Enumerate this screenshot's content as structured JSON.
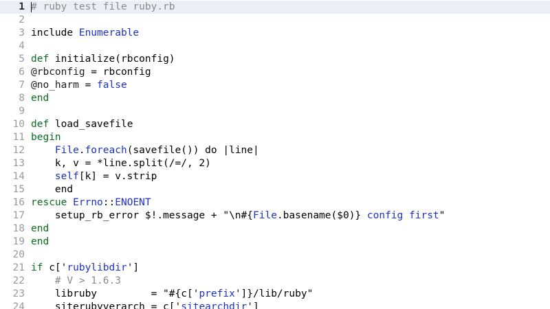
{
  "editor": {
    "colors": {
      "keyword": "#0a6c1f",
      "constant": "#1b31c9",
      "string": "#000000",
      "comment": "#8a8a8a",
      "ivar": "#1a1a1a",
      "plain": "#000000",
      "lineNumber": "#9a9a9a",
      "currentLine": "#ebeff5"
    },
    "current_line": 1,
    "lines": [
      {
        "num": "1",
        "tokens": [
          {
            "t": "# ruby test file ruby.rb",
            "c": "comment"
          }
        ]
      },
      {
        "num": "2",
        "tokens": []
      },
      {
        "num": "3",
        "tokens": [
          {
            "t": "include ",
            "c": "plain"
          },
          {
            "t": "Enumerable",
            "c": "constant"
          }
        ]
      },
      {
        "num": "4",
        "tokens": []
      },
      {
        "num": "5",
        "tokens": [
          {
            "t": "def",
            "c": "keyword"
          },
          {
            "t": " initialize(rbconfig)",
            "c": "plain"
          }
        ]
      },
      {
        "num": "6",
        "tokens": [
          {
            "t": "@rbconfig",
            "c": "ivar"
          },
          {
            "t": " = rbconfig",
            "c": "plain"
          }
        ]
      },
      {
        "num": "7",
        "tokens": [
          {
            "t": "@no_harm",
            "c": "ivar"
          },
          {
            "t": " = ",
            "c": "plain"
          },
          {
            "t": "false",
            "c": "constant"
          }
        ]
      },
      {
        "num": "8",
        "tokens": [
          {
            "t": "end",
            "c": "keyword"
          }
        ]
      },
      {
        "num": "9",
        "tokens": []
      },
      {
        "num": "10",
        "tokens": [
          {
            "t": "def",
            "c": "keyword"
          },
          {
            "t": " load_savefile",
            "c": "plain"
          }
        ]
      },
      {
        "num": "11",
        "tokens": [
          {
            "t": "begin",
            "c": "keyword"
          }
        ]
      },
      {
        "num": "12",
        "tokens": [
          {
            "t": "    ",
            "c": "plain"
          },
          {
            "t": "File",
            "c": "constant"
          },
          {
            "t": ".",
            "c": "plain"
          },
          {
            "t": "foreach",
            "c": "constant"
          },
          {
            "t": "(savefile()) do |line|",
            "c": "plain"
          }
        ]
      },
      {
        "num": "13",
        "tokens": [
          {
            "t": "    k, v = *line.split(/=/, 2)",
            "c": "plain"
          }
        ]
      },
      {
        "num": "14",
        "tokens": [
          {
            "t": "    ",
            "c": "plain"
          },
          {
            "t": "self",
            "c": "constant"
          },
          {
            "t": "[k] = v.strip",
            "c": "plain"
          }
        ]
      },
      {
        "num": "15",
        "tokens": [
          {
            "t": "    end",
            "c": "plain"
          }
        ]
      },
      {
        "num": "16",
        "tokens": [
          {
            "t": "rescue",
            "c": "keyword"
          },
          {
            "t": " ",
            "c": "plain"
          },
          {
            "t": "Errno",
            "c": "constant"
          },
          {
            "t": "::",
            "c": "plain"
          },
          {
            "t": "ENOENT",
            "c": "constant"
          }
        ]
      },
      {
        "num": "17",
        "tokens": [
          {
            "t": "    setup_rb_error $!.message + \"\\n#{",
            "c": "plain"
          },
          {
            "t": "File",
            "c": "constant"
          },
          {
            "t": ".basename($0)} ",
            "c": "plain"
          },
          {
            "t": "config first",
            "c": "constant"
          },
          {
            "t": "\"",
            "c": "plain"
          }
        ]
      },
      {
        "num": "18",
        "tokens": [
          {
            "t": "end",
            "c": "keyword"
          }
        ]
      },
      {
        "num": "19",
        "tokens": [
          {
            "t": "end",
            "c": "keyword"
          }
        ]
      },
      {
        "num": "20",
        "tokens": []
      },
      {
        "num": "21",
        "tokens": [
          {
            "t": "if",
            "c": "keyword"
          },
          {
            "t": " c['",
            "c": "plain"
          },
          {
            "t": "rubylibdir",
            "c": "constant"
          },
          {
            "t": "']",
            "c": "plain"
          }
        ]
      },
      {
        "num": "22",
        "tokens": [
          {
            "t": "    # V > 1.6.3",
            "c": "comment"
          }
        ]
      },
      {
        "num": "23",
        "tokens": [
          {
            "t": "    libruby         = \"#{c['",
            "c": "plain"
          },
          {
            "t": "prefix",
            "c": "constant"
          },
          {
            "t": "']}/lib/ruby\"",
            "c": "plain"
          }
        ]
      },
      {
        "num": "24",
        "tokens": [
          {
            "t": "    siterubyverarch = c['",
            "c": "plain"
          },
          {
            "t": "sitearchdir",
            "c": "constant"
          },
          {
            "t": "']",
            "c": "plain"
          }
        ]
      }
    ]
  }
}
